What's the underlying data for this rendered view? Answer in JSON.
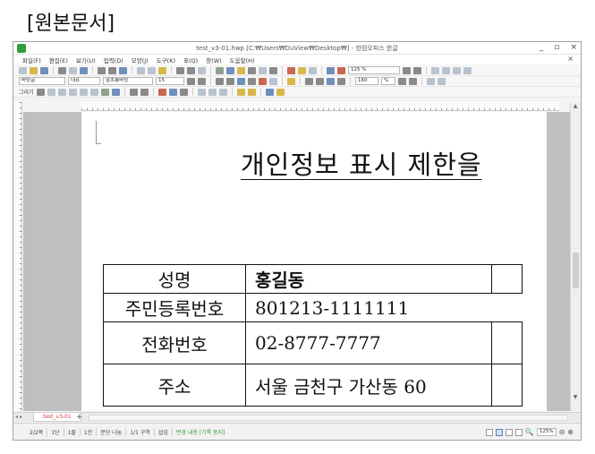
{
  "caption": "[원본문서]",
  "window": {
    "title": "test_v3-01.hwp [C:₩Users₩DuView₩Desktop₩] - 한컴오피스 한글",
    "minimize": "_",
    "maximize": "▫",
    "close": "×",
    "mdi_close": "×"
  },
  "menu": [
    "파일(F)",
    "편집(E)",
    "보기(U)",
    "입력(D)",
    "모양(J)",
    "도구(K)",
    "표(Q)",
    "창(W)",
    "도움말(H)"
  ],
  "toolbar": {
    "zoom": "125 %",
    "style": "바탕글",
    "lang": "대표",
    "font": "함초롬바탕",
    "size": "15",
    "line_spacing": "160",
    "line_unit": "%",
    "draw_label": "그리기"
  },
  "document": {
    "title": "개인정보 표시 제한을",
    "table": [
      {
        "label": "성명",
        "value": "홍길동"
      },
      {
        "label": "주민등록번호",
        "value": "801213-1111111"
      },
      {
        "label": "전화번호",
        "value": "02-8777-7777"
      },
      {
        "label": "주소",
        "value": "서울 금천구 가산동 60"
      }
    ]
  },
  "tabs": {
    "doc_tab": "test_v3-01",
    "add": "+"
  },
  "status": {
    "page": "2/2쪽",
    "section": "1단",
    "line": "1줄",
    "col": "1칸",
    "break": "문단 나눔",
    "area": "1/1 구역",
    "mode": "삽입",
    "track": "변경 내용 [기록 중지]",
    "zoom": "125%",
    "zoom_minus": "⊖",
    "zoom_plus": "⊕"
  }
}
